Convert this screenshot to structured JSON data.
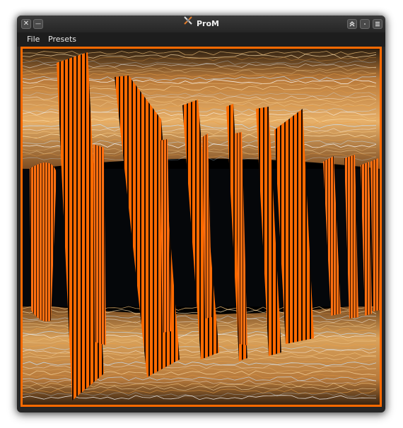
{
  "window": {
    "title": "ProM",
    "controls": {
      "close_glyph": "✕",
      "minimize_glyph": "—",
      "maximize_icon": "chevrons-up-icon",
      "sticky_icon": "dot-icon",
      "menu_icon": "hamburger-icon"
    }
  },
  "menubar": {
    "items": [
      {
        "label": "File"
      },
      {
        "label": "Presets"
      }
    ]
  },
  "visualization": {
    "accent_color": "#ff6a00",
    "background_color": "#000000",
    "streak_colors": [
      "#f2c27a",
      "#ffe3b0",
      "#e8a048",
      "#c6e4ff",
      "#ffffff"
    ]
  }
}
